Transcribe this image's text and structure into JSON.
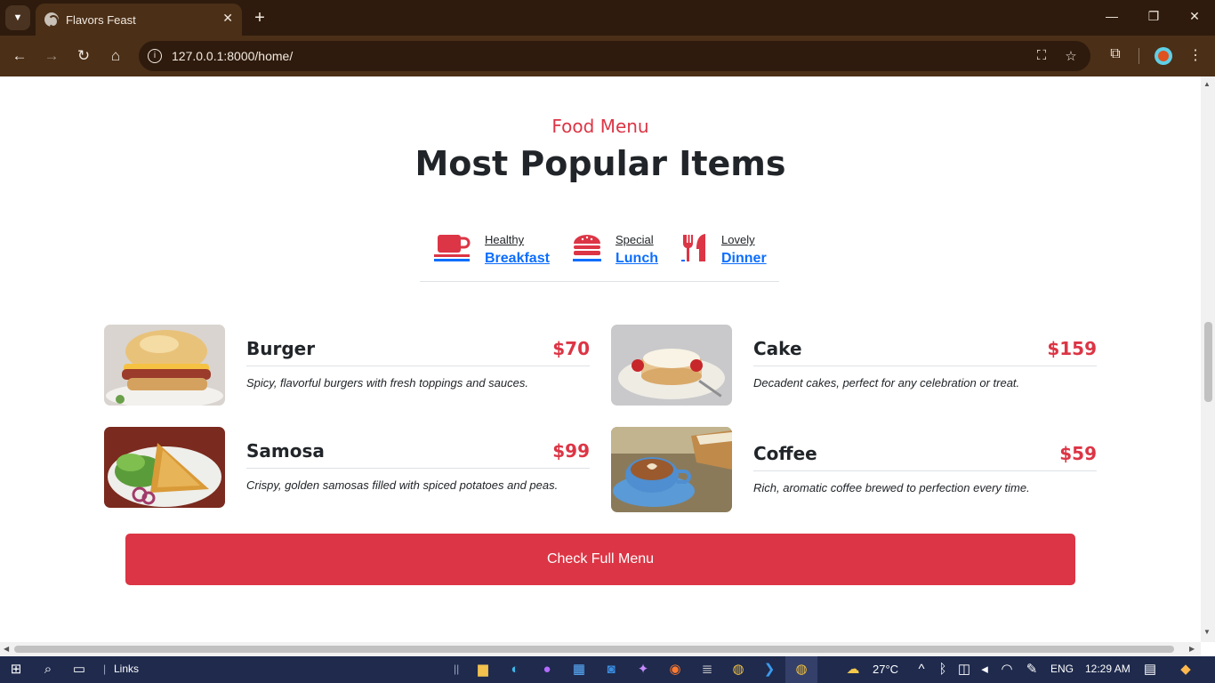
{
  "browser": {
    "tab_title": "Flavors Feast",
    "url": "127.0.0.1:8000/home/",
    "tab_close": "✕",
    "new_tab": "+"
  },
  "page": {
    "subtitle": "Food Menu",
    "title": "Most Popular Items",
    "tabs": [
      {
        "small": "Healthy",
        "big": "Breakfast",
        "icon": "coffee-cup-icon"
      },
      {
        "small": "Special",
        "big": "Lunch",
        "icon": "hamburger-icon"
      },
      {
        "small": "Lovely",
        "big": "Dinner",
        "icon": "utensils-icon"
      }
    ],
    "items": [
      {
        "name": "Burger",
        "price": "$70",
        "desc": "Spicy, flavorful burgers with fresh toppings and sauces."
      },
      {
        "name": "Cake",
        "price": "$159",
        "desc": "Decadent cakes, perfect for any celebration or treat."
      },
      {
        "name": "Samosa",
        "price": "$99",
        "desc": "Crispy, golden samosas filled with spiced potatoes and peas."
      },
      {
        "name": "Coffee",
        "price": "$59",
        "desc": "Rich, aromatic coffee brewed to perfection every time."
      }
    ],
    "cta": "Check Full Menu"
  },
  "taskbar": {
    "links_label": "Links",
    "temperature": "27°C",
    "language": "ENG",
    "time": "12:29 AM"
  },
  "colors": {
    "accent": "#dc3545",
    "link": "#0d6efd",
    "chrome_dark": "#2e1b0d",
    "chrome": "#4b2f17",
    "taskbar": "#1f2a4d"
  }
}
